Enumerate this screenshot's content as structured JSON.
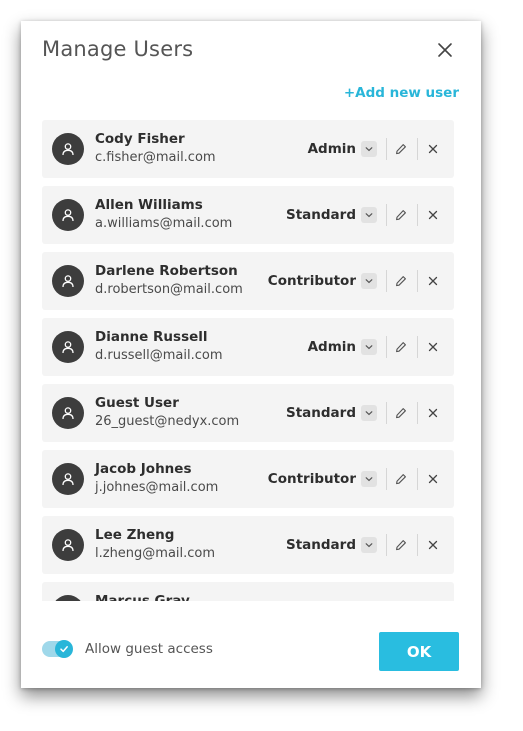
{
  "dialog": {
    "title": "Manage Users",
    "add_user_label": "+Add new user",
    "guest_access_label": "Allow guest access",
    "guest_access_enabled": true,
    "ok_label": "OK"
  },
  "users": [
    {
      "name": "Cody Fisher",
      "email": "c.fisher@mail.com",
      "role": "Admin"
    },
    {
      "name": "Allen Williams",
      "email": "a.williams@mail.com",
      "role": "Standard"
    },
    {
      "name": "Darlene Robertson",
      "email": "d.robertson@mail.com",
      "role": "Contributor"
    },
    {
      "name": "Dianne Russell",
      "email": "d.russell@mail.com",
      "role": "Admin"
    },
    {
      "name": "Guest User",
      "email": "26_guest@nedyx.com",
      "role": "Standard"
    },
    {
      "name": "Jacob Johnes",
      "email": "j.johnes@mail.com",
      "role": "Contributor"
    },
    {
      "name": "Lee Zheng",
      "email": "l.zheng@mail.com",
      "role": "Standard"
    },
    {
      "name": "Marcus Gray",
      "email": "",
      "role": ""
    }
  ],
  "icons": {
    "close": "close-icon",
    "avatar": "user-icon",
    "role_dropdown": "chevron-down-icon",
    "edit": "pencil-icon",
    "delete": "x-icon",
    "toggle": "check-icon"
  },
  "colors": {
    "accent": "#29b6d9",
    "row_background": "#f4f4f4",
    "avatar_background": "#3d3d3d"
  }
}
